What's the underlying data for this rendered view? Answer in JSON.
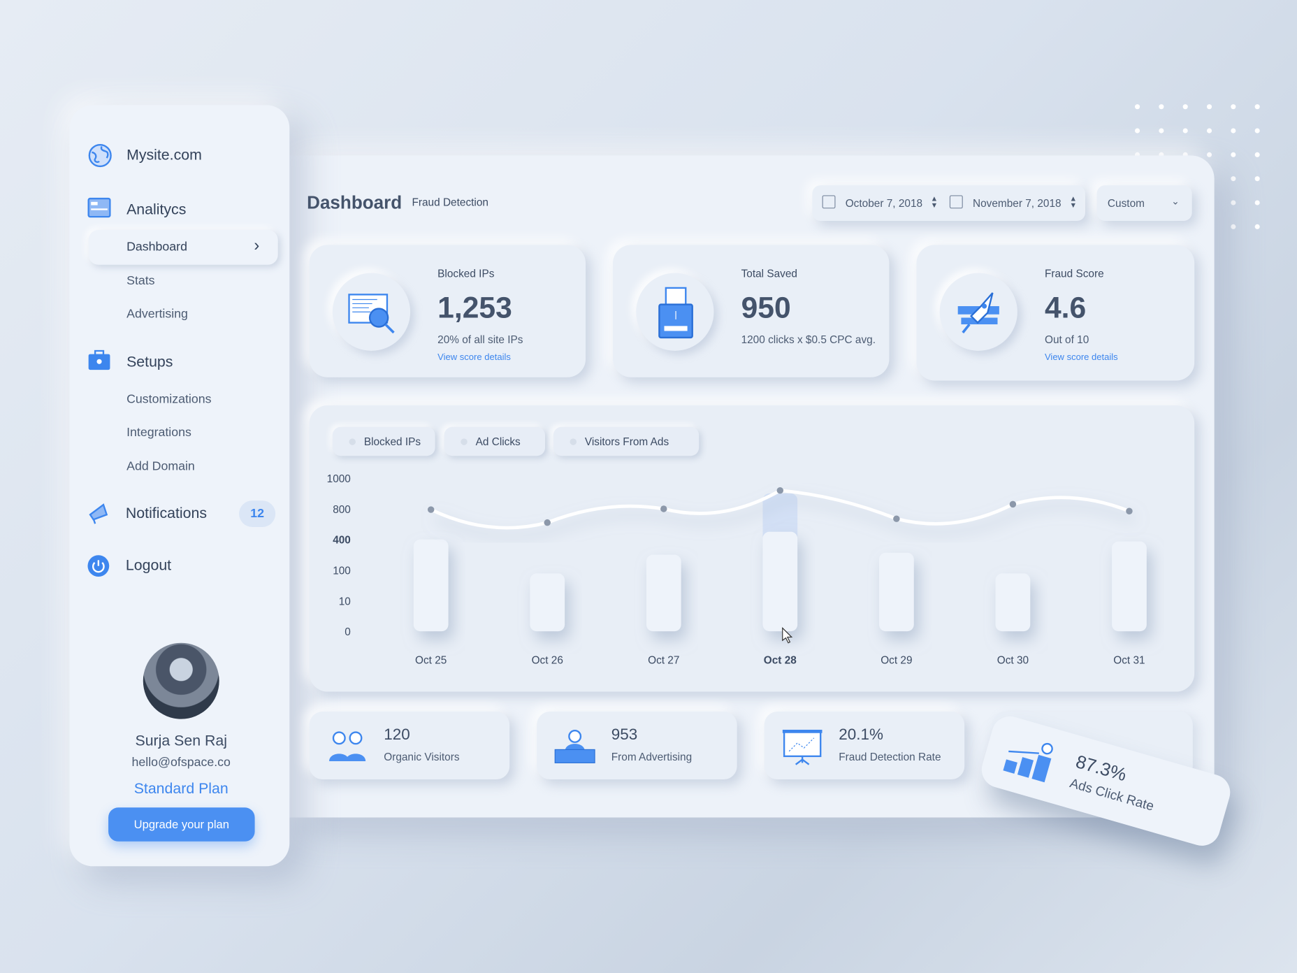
{
  "brand": {
    "name": "Mysite.com",
    "icon": "globe-icon"
  },
  "sidebar": {
    "analytics": {
      "label": "Analitycs",
      "items": [
        {
          "label": "Dashboard",
          "active": true
        },
        {
          "label": "Stats"
        },
        {
          "label": "Advertising"
        }
      ]
    },
    "setups": {
      "label": "Setups",
      "items": [
        {
          "label": "Customizations"
        },
        {
          "label": "Integrations"
        },
        {
          "label": "Add Domain"
        }
      ]
    },
    "notifications": {
      "label": "Notifications",
      "count": "12"
    },
    "logout": {
      "label": "Logout"
    },
    "profile": {
      "name": "Surja Sen Raj",
      "email": "hello@ofspace.co",
      "plan": "Standard Plan",
      "upgrade": "Upgrade your plan"
    }
  },
  "header": {
    "title": "Dashboard",
    "subtitle": "Fraud Detection",
    "date_from": "October 7, 2018",
    "date_to": "November 7, 2018",
    "range": "Custom"
  },
  "kpis": [
    {
      "label": "Blocked IPs",
      "value": "1,253",
      "note": "20% of all site IPs",
      "link": "View score details"
    },
    {
      "label": "Total Saved",
      "value": "950",
      "note": "1200 clicks x $0.5 CPC avg."
    },
    {
      "label": "Fraud Score",
      "value": "4.6",
      "note": "Out of 10",
      "link": "View score details"
    }
  ],
  "chart_data": {
    "type": "bar",
    "legend": [
      "Blocked IPs",
      "Ad Clicks",
      "Visitors From Ads"
    ],
    "categories": [
      "Oct 25",
      "Oct 26",
      "Oct 27",
      "Oct 28",
      "Oct 29",
      "Oct 30",
      "Oct 31"
    ],
    "highlight": "Oct 28",
    "y_ticks": [
      "1000",
      "800",
      "400",
      "100",
      "10",
      "0"
    ],
    "series": [
      {
        "kind": "bar",
        "values": [
          400,
          90,
          250,
          500,
          270,
          90,
          380
        ]
      },
      {
        "kind": "line",
        "values": [
          790,
          620,
          800,
          920,
          670,
          830,
          770
        ]
      }
    ],
    "highlight_bar_top": 900
  },
  "stats": [
    {
      "value": "120",
      "label": "Organic Visitors"
    },
    {
      "value": "953",
      "label": "From Advertising"
    },
    {
      "value": "20.1%",
      "label": "Fraud Detection Rate"
    },
    {
      "value": "87.3%",
      "label": "Ads Click Rate"
    }
  ],
  "colors": {
    "accent": "#3d86ee",
    "text": "#3c4b63",
    "panel": "#edf2f9"
  }
}
